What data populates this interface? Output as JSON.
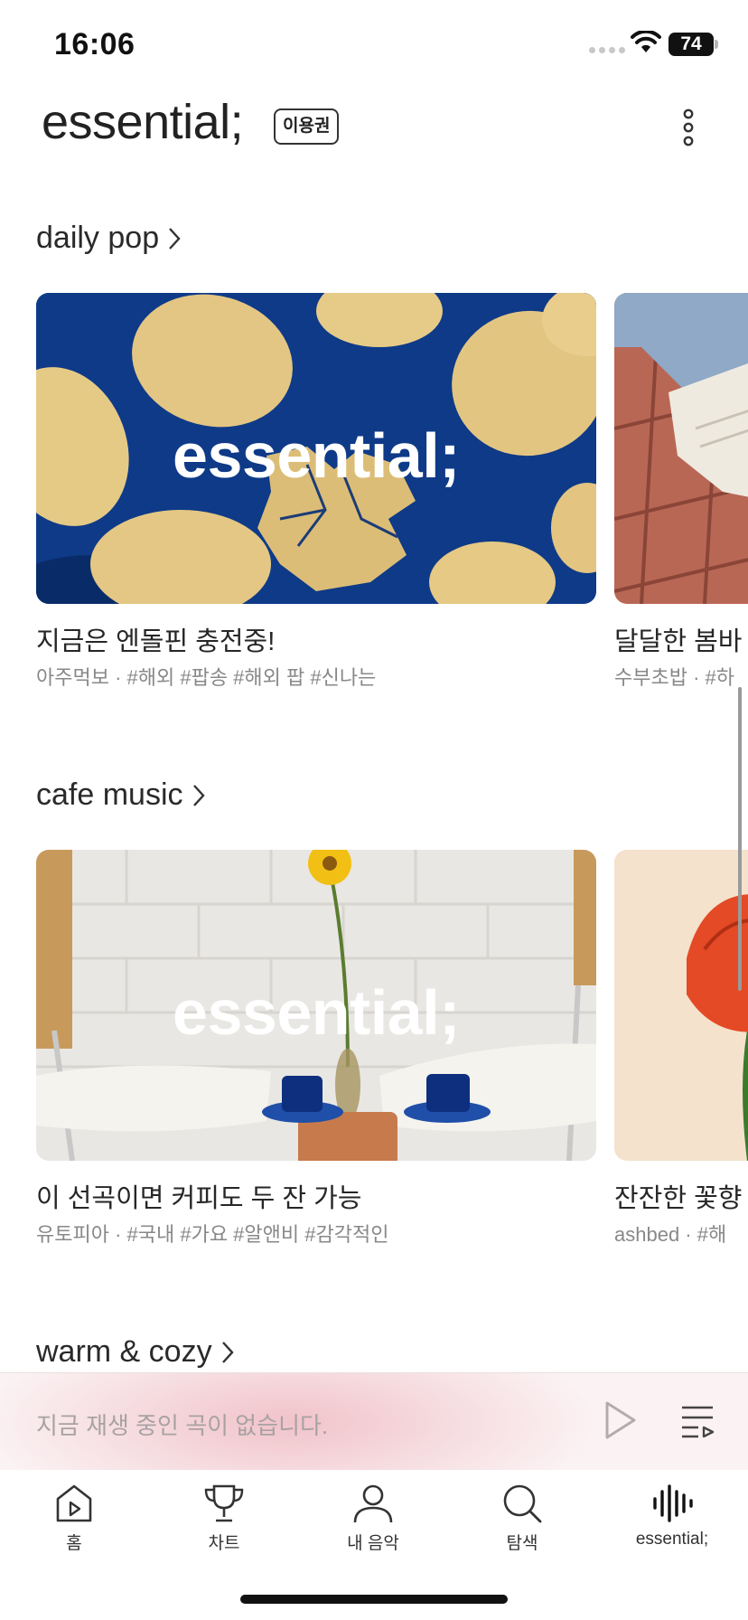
{
  "status_bar": {
    "time": "16:06",
    "battery": "74"
  },
  "header": {
    "logo": "essential;",
    "badge": "이용권"
  },
  "sections": [
    {
      "title": "daily pop",
      "cards": [
        {
          "overlay": "essential;",
          "title": "지금은 엔돌핀 충전중!",
          "meta": "아주먹보 · #해외 #팝송 #해외 팝 #신나는"
        },
        {
          "title": "달달한 봄바",
          "meta": "수부초밥 · #하"
        }
      ]
    },
    {
      "title": "cafe music",
      "cards": [
        {
          "overlay": "essential;",
          "title": "이 선곡이면 커피도 두 잔 가능",
          "meta": "유토피아 · #국내 #가요 #알앤비 #감각적인"
        },
        {
          "title": "잔잔한 꽃향",
          "meta": "ashbed · #해"
        }
      ]
    },
    {
      "title": "warm & cozy"
    }
  ],
  "player": {
    "empty_text": "지금 재생 중인 곡이 없습니다."
  },
  "tabs": [
    {
      "label": "홈",
      "icon": "home-play-icon"
    },
    {
      "label": "차트",
      "icon": "trophy-icon"
    },
    {
      "label": "내 음악",
      "icon": "person-icon"
    },
    {
      "label": "탐색",
      "icon": "search-icon"
    },
    {
      "label": "essential;",
      "icon": "sound-bars-icon"
    }
  ]
}
